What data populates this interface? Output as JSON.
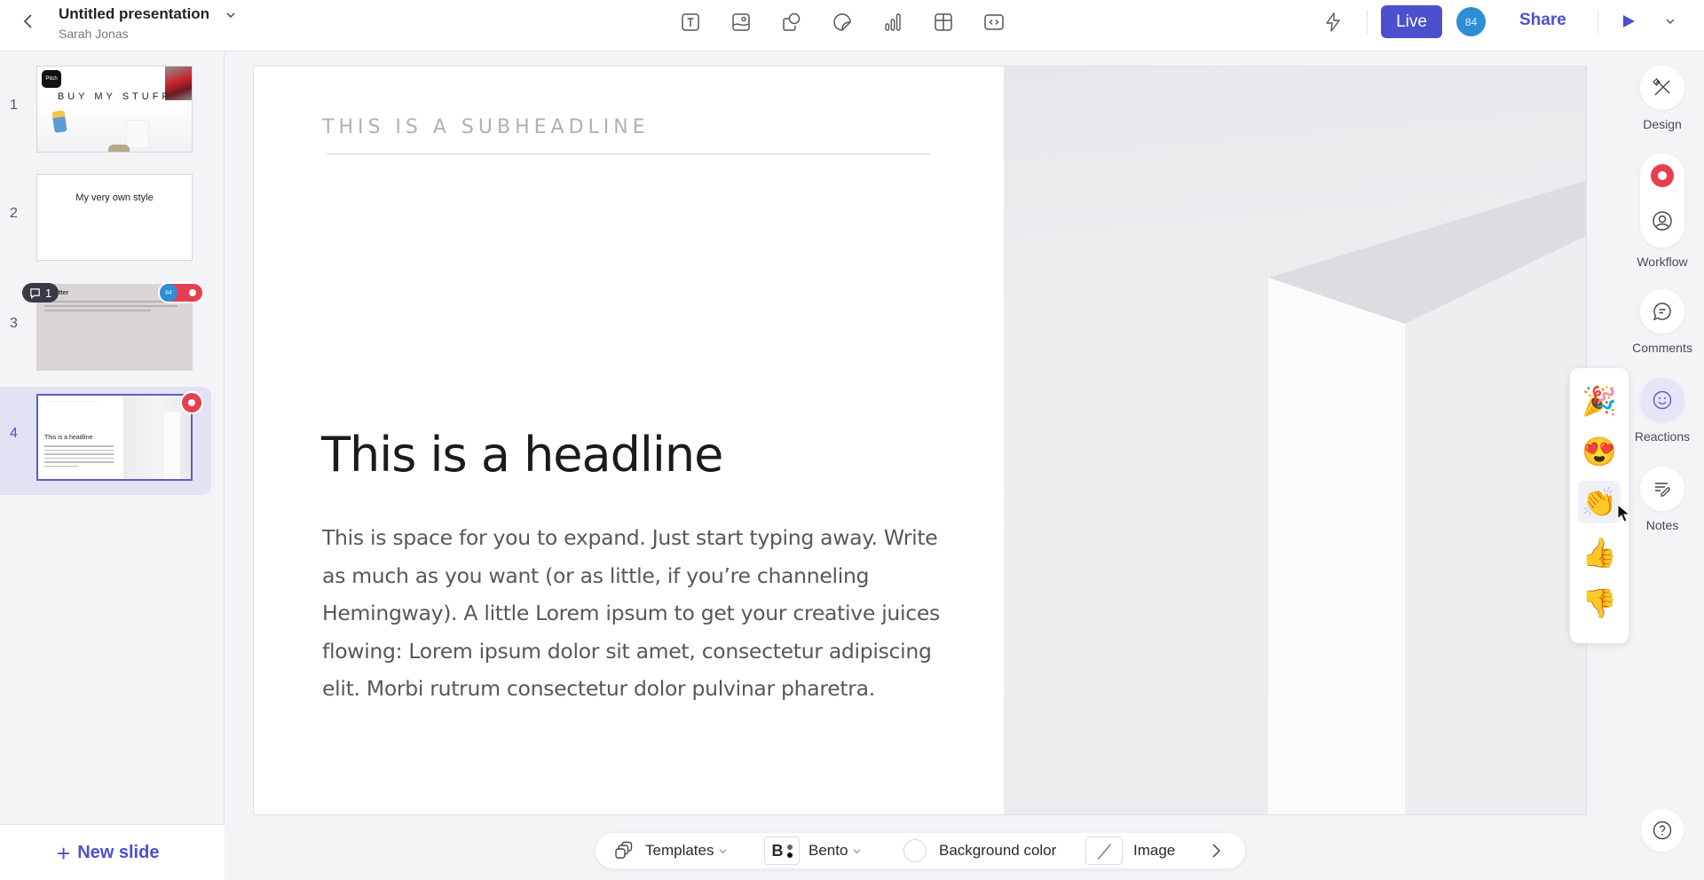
{
  "header": {
    "title": "Untitled presentation",
    "owner": "Sarah Jonas",
    "insert_tools": [
      "text-icon",
      "image-icon",
      "shape-icon",
      "sticker-icon",
      "chart-icon",
      "table-icon",
      "embed-icon"
    ],
    "live_label": "Live",
    "avatar_initials": "84",
    "share_label": "Share",
    "accent_color": "#4b50cf"
  },
  "sidebar": {
    "slides": [
      {
        "number": "1",
        "title": "BUY MY STUFF",
        "active": false
      },
      {
        "number": "2",
        "title": "My very own style",
        "active": false
      },
      {
        "number": "3",
        "title": "... better",
        "active": false,
        "comment_count": "1",
        "collaborator": "84"
      },
      {
        "number": "4",
        "title": "This is a headline",
        "active": true
      }
    ],
    "thumb1_logo": "Pitch",
    "new_slide_label": "New slide"
  },
  "slide": {
    "subheadline": "THIS IS A SUBHEADLINE",
    "headline": "This is a headline",
    "body": "This is space for you to expand. Just start typing away. Write as much as you want (or as little, if you’re channeling Hemingway). A little Lorem ipsum to get your creative juices flowing: Lorem ipsum dolor sit amet, consectetur adipiscing elit. Morbi rutrum consectetur dolor pulvinar pharetra."
  },
  "right_rail": {
    "design_label": "Design",
    "workflow_label": "Workflow",
    "comments_label": "Comments",
    "reactions_label": "Reactions",
    "notes_label": "Notes"
  },
  "reactions": [
    {
      "name": "party-popper",
      "emoji": "🎉"
    },
    {
      "name": "heart-eyes",
      "emoji": "😍"
    },
    {
      "name": "clapping-hands",
      "emoji": "👏"
    },
    {
      "name": "thumbs-up",
      "emoji": "👍"
    },
    {
      "name": "thumbs-down",
      "emoji": "👎"
    }
  ],
  "bottom_bar": {
    "templates_label": "Templates",
    "theme_label": "Bento",
    "theme_icon_letter": "B",
    "background_label": "Background color",
    "image_label": "Image"
  }
}
